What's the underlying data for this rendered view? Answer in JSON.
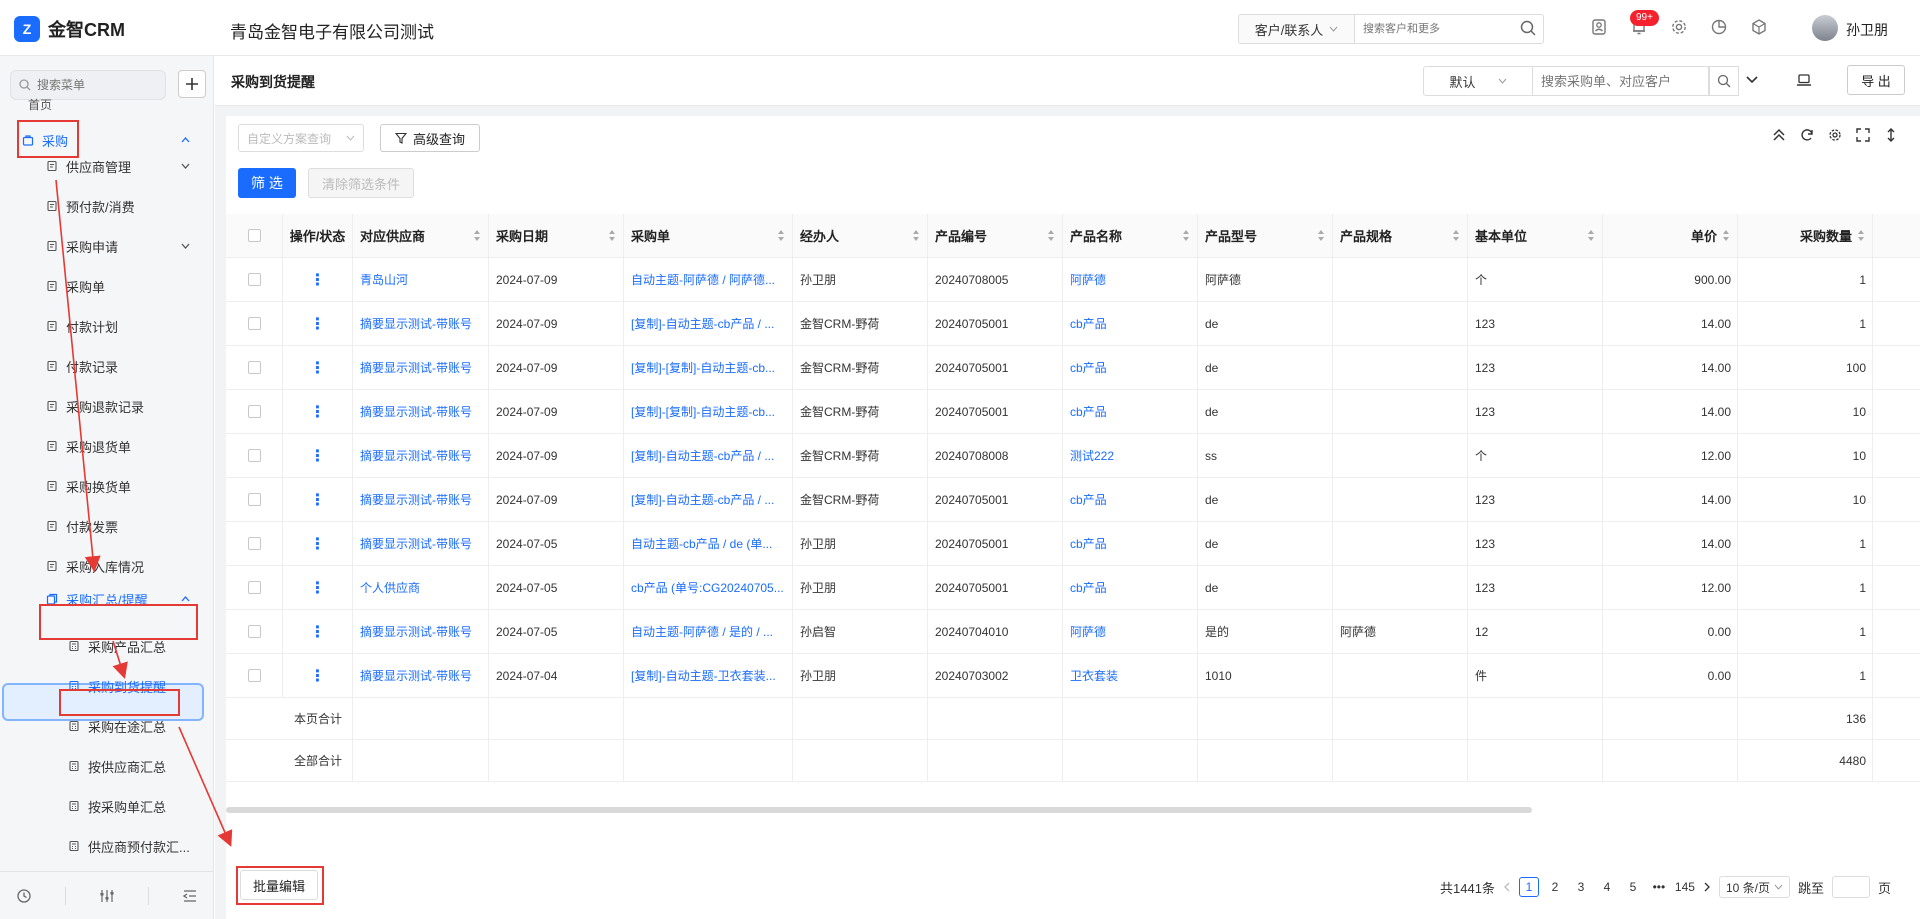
{
  "topbar": {
    "logo_mark": "Z",
    "app_name": "金智CRM",
    "company": "青岛金智电子有限公司测试",
    "scope_select": "客户/联系人",
    "search_placeholder": "搜索客户和更多",
    "notification_badge": "99+",
    "username": "孙卫朋"
  },
  "sidebar": {
    "search_placeholder": "搜索菜单",
    "prev_item": "首页",
    "procurement": "采购",
    "items": [
      {
        "label": "供应商管理",
        "icon": "copy-icon"
      },
      {
        "label": "预付款/消费",
        "icon": "wallet-icon"
      },
      {
        "label": "采购申请",
        "icon": "copy-icon"
      },
      {
        "label": "采购单",
        "icon": "bag-icon"
      },
      {
        "label": "付款计划",
        "icon": "doc-icon"
      },
      {
        "label": "付款记录",
        "icon": "doc-icon"
      },
      {
        "label": "采购退款记录",
        "icon": "refund-icon"
      },
      {
        "label": "采购退货单",
        "icon": "doc-icon"
      },
      {
        "label": "采购换货单",
        "icon": "doc-icon"
      },
      {
        "label": "付款发票",
        "icon": "invoice-icon"
      },
      {
        "label": "采购入库情况",
        "icon": "doc-icon"
      }
    ],
    "summary_group": "采购汇总/提醒",
    "sub_items": [
      {
        "label": "采购产品汇总"
      },
      {
        "label": "采购到货提醒"
      },
      {
        "label": "采购在途汇总"
      },
      {
        "label": "按供应商汇总"
      },
      {
        "label": "按采购单汇总"
      },
      {
        "label": "供应商预付款汇..."
      }
    ]
  },
  "header": {
    "title": "采购到货提醒",
    "view_select": "默认",
    "search_placeholder": "搜索采购单、对应客户",
    "export_label": "导 出"
  },
  "toolbar": {
    "scheme_placeholder": "自定义方案查询",
    "advanced_query": "高级查询",
    "filter": "筛 选",
    "clear_filter": "清除筛选条件"
  },
  "table": {
    "columns": [
      "操作/状态",
      "对应供应商",
      "采购日期",
      "采购单",
      "经办人",
      "产品编号",
      "产品名称",
      "产品型号",
      "产品规格",
      "基本单位",
      "单价",
      "采购数量"
    ],
    "rows": [
      {
        "supplier": "青岛山河",
        "date": "2024-07-09",
        "order": "自动主题-阿萨德 / 阿萨德...",
        "handler": "孙卫朋",
        "code": "20240708005",
        "product": "阿萨德",
        "model": "阿萨德",
        "spec": "",
        "unit": "个",
        "price": "900.00",
        "qty": "1"
      },
      {
        "supplier": "摘要显示测试-带账号",
        "date": "2024-07-09",
        "order": "[复制]-自动主题-cb产品 / ...",
        "handler": "金智CRM-野荷",
        "code": "20240705001",
        "product": "cb产品",
        "model": "de",
        "spec": "",
        "unit": "123",
        "price": "14.00",
        "qty": "1"
      },
      {
        "supplier": "摘要显示测试-带账号",
        "date": "2024-07-09",
        "order": "[复制]-[复制]-自动主题-cb...",
        "handler": "金智CRM-野荷",
        "code": "20240705001",
        "product": "cb产品",
        "model": "de",
        "spec": "",
        "unit": "123",
        "price": "14.00",
        "qty": "100"
      },
      {
        "supplier": "摘要显示测试-带账号",
        "date": "2024-07-09",
        "order": "[复制]-[复制]-自动主题-cb...",
        "handler": "金智CRM-野荷",
        "code": "20240705001",
        "product": "cb产品",
        "model": "de",
        "spec": "",
        "unit": "123",
        "price": "14.00",
        "qty": "10"
      },
      {
        "supplier": "摘要显示测试-带账号",
        "date": "2024-07-09",
        "order": "[复制]-自动主题-cb产品 / ...",
        "handler": "金智CRM-野荷",
        "code": "20240708008",
        "product": "测试222",
        "model": "ss",
        "spec": "",
        "unit": "个",
        "price": "12.00",
        "qty": "10"
      },
      {
        "supplier": "摘要显示测试-带账号",
        "date": "2024-07-09",
        "order": "[复制]-自动主题-cb产品 / ...",
        "handler": "金智CRM-野荷",
        "code": "20240705001",
        "product": "cb产品",
        "model": "de",
        "spec": "",
        "unit": "123",
        "price": "14.00",
        "qty": "10"
      },
      {
        "supplier": "摘要显示测试-带账号",
        "date": "2024-07-05",
        "order": "自动主题-cb产品 / de (单...",
        "handler": "孙卫朋",
        "code": "20240705001",
        "product": "cb产品",
        "model": "de",
        "spec": "",
        "unit": "123",
        "price": "14.00",
        "qty": "1"
      },
      {
        "supplier": "个人供应商",
        "date": "2024-07-05",
        "order": "cb产品 (单号:CG20240705...",
        "handler": "孙卫朋",
        "code": "20240705001",
        "product": "cb产品",
        "model": "de",
        "spec": "",
        "unit": "123",
        "price": "12.00",
        "qty": "1"
      },
      {
        "supplier": "摘要显示测试-带账号",
        "date": "2024-07-05",
        "order": "自动主题-阿萨德 / 是的 / ...",
        "handler": "孙启智",
        "code": "20240704010",
        "product": "阿萨德",
        "model": "是的",
        "spec": "阿萨德",
        "unit": "12",
        "price": "0.00",
        "qty": "1"
      },
      {
        "supplier": "摘要显示测试-带账号",
        "date": "2024-07-04",
        "order": "[复制]-自动主题-卫衣套装...",
        "handler": "孙卫朋",
        "code": "20240703002",
        "product": "卫衣套装",
        "model": "1010",
        "spec": "",
        "unit": "件",
        "price": "0.00",
        "qty": "1"
      }
    ],
    "page_total_label": "本页合计",
    "page_total_qty": "136",
    "all_total_label": "全部合计",
    "all_total_qty": "4480"
  },
  "footer": {
    "batch_edit": "批量编辑",
    "total": "共1441条",
    "pages": [
      "1",
      "2",
      "3",
      "4",
      "5",
      "•••",
      "145"
    ],
    "page_size": "10 条/页",
    "jump_label": "跳至",
    "page_unit": "页"
  },
  "colors": {
    "accent": "#1a6cff",
    "annotation": "#e53935"
  }
}
